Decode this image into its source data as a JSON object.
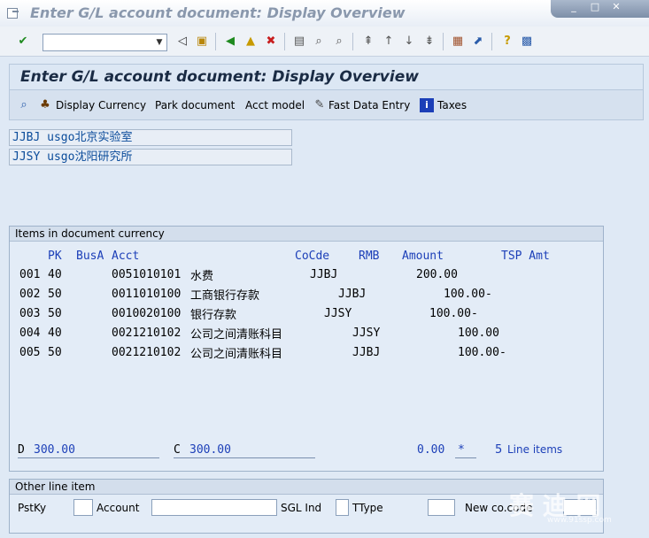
{
  "window": {
    "title": "Enter G/L account document: Display Overview",
    "controls": [
      "_",
      "□",
      "✕"
    ]
  },
  "toolbar": {
    "command_value": ""
  },
  "page": {
    "title": "Enter G/L account document: Display Overview"
  },
  "app_toolbar": {
    "display_currency": "Display Currency",
    "park_document": "Park document",
    "acct_model": "Acct model",
    "fast_data_entry": "Fast Data Entry",
    "taxes": "Taxes"
  },
  "company_codes": [
    "JJBJ usgo北京实验室",
    "JJSY usgo沈阳研究所"
  ],
  "items": {
    "title": "Items in document currency",
    "headers": {
      "pk": "PK",
      "busa": "BusA",
      "acct": "Acct",
      "cocde": "CoCde",
      "rmb": "RMB",
      "amount": "Amount",
      "tsp_amt": "TSP Amt"
    },
    "rows": [
      {
        "no": "001",
        "pk": "40",
        "acct": "0051010101",
        "desc": "水费",
        "cocde": "JJBJ",
        "amount": "200.00"
      },
      {
        "no": "002",
        "pk": "50",
        "acct": "0011010100",
        "desc": "工商银行存款",
        "cocde": "JJBJ",
        "amount": "100.00-"
      },
      {
        "no": "003",
        "pk": "50",
        "acct": "0010020100",
        "desc": "银行存款",
        "cocde": "JJSY",
        "amount": "100.00-"
      },
      {
        "no": "004",
        "pk": "40",
        "acct": "0021210102",
        "desc": "公司之间清账科目",
        "cocde": "JJSY",
        "amount": "100.00"
      },
      {
        "no": "005",
        "pk": "50",
        "acct": "0021210102",
        "desc": "公司之间清账科目",
        "cocde": "JJBJ",
        "amount": "100.00-"
      }
    ],
    "totals": {
      "d_label": "D",
      "d_value": "300.00",
      "c_label": "C",
      "c_value": "300.00",
      "balance": "0.00",
      "star": "*",
      "line_count": "5",
      "line_items_label": "Line items"
    }
  },
  "other_line": {
    "title": "Other line item",
    "pstky_label": "PstKy",
    "account_label": "Account",
    "sgl_label": "SGL Ind",
    "ttype_label": "TType",
    "newcc_label": "New co.code",
    "pstky_value": "",
    "account_value": "",
    "sgl_value": "",
    "ttype_value": "",
    "newcc_value": ""
  },
  "watermark": {
    "text": "赛 迪 网",
    "url": "www.91ssp.com"
  }
}
